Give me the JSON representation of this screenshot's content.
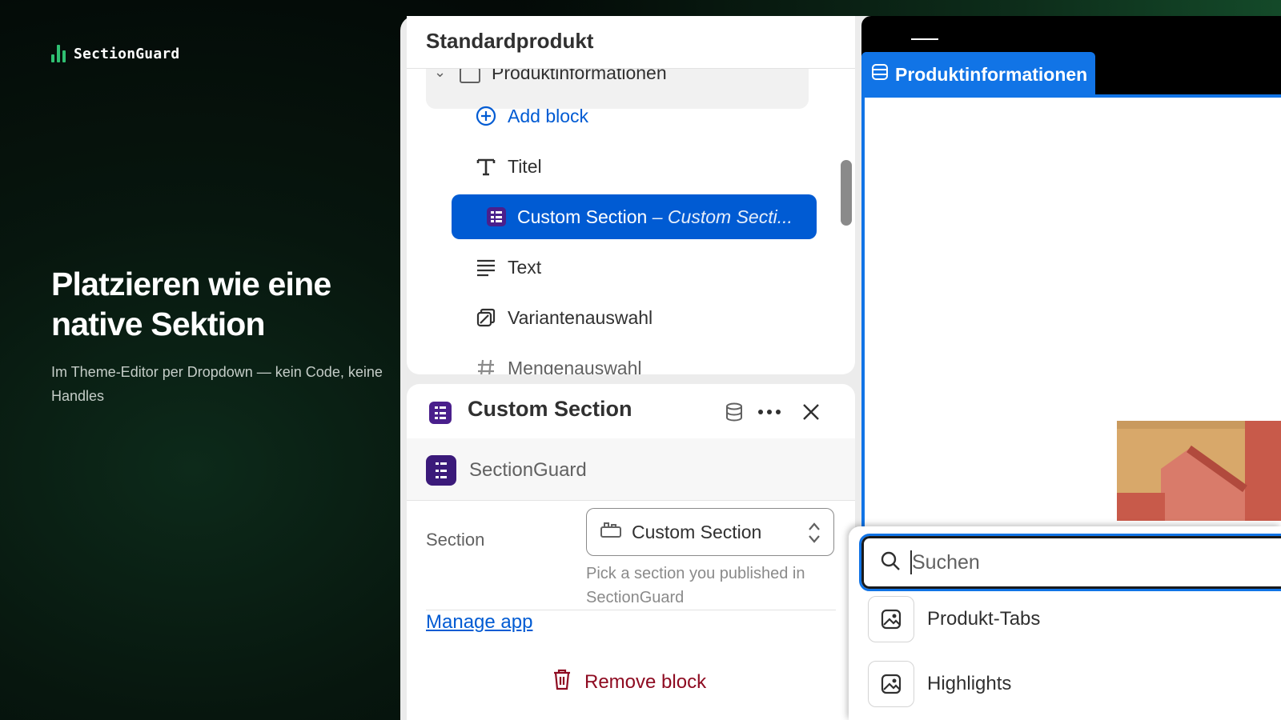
{
  "brand": {
    "name": "SectionGuard"
  },
  "hero": {
    "headline": "Platzieren wie eine native Sektion",
    "subline": "Im Theme-Editor per Dropdown — kein Code, keine Handles"
  },
  "tree": {
    "title": "Standardprodukt",
    "parent_label": "Produktinformationen",
    "items": [
      {
        "label": "Add block",
        "icon": "plus-circle-icon"
      },
      {
        "label": "Titel",
        "icon": "text-title-icon"
      },
      {
        "label": "Custom Section",
        "suffix": "– Custom Secti...",
        "icon": "app-block-icon",
        "selected": true
      },
      {
        "label": "Text",
        "icon": "text-lines-icon"
      },
      {
        "label": "Variantenauswahl",
        "icon": "variant-icon"
      },
      {
        "label": "Mengenauswahl",
        "icon": "hash-icon"
      }
    ]
  },
  "detail": {
    "title": "Custom Section",
    "app_name": "SectionGuard",
    "field_label": "Section",
    "select_value": "Custom Section",
    "help_text": "Pick a section you published in SectionGuard",
    "manage_link": "Manage app",
    "remove_label": "Remove block"
  },
  "preview": {
    "tab_label": "Produktinformationen"
  },
  "popover": {
    "search_placeholder": "Suchen",
    "options": [
      {
        "label": "Produkt-Tabs",
        "icon": "image-icon"
      },
      {
        "label": "Highlights",
        "icon": "image-icon"
      }
    ]
  },
  "colors": {
    "accent": "#005bd3",
    "preview_accent": "#1174e6",
    "brand_green": "#2fbf71",
    "critical": "#8e0b21",
    "app_icon": "#4a1f8c"
  }
}
